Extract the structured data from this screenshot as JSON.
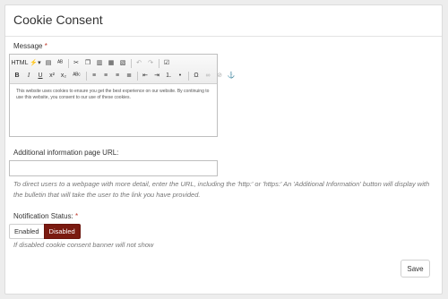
{
  "panel": {
    "title": "Cookie Consent"
  },
  "message": {
    "label": "Message",
    "required_mark": "*",
    "editor_text": "This website uses cookies to ensure you get the best experience on our website. By continuing to use this website, you consent to our use of these cookies."
  },
  "toolbar": {
    "row1": [
      {
        "name": "source-html-icon",
        "glyph": "HTML"
      },
      {
        "name": "special-char-dropdown-icon",
        "glyph": "⚡▾"
      },
      {
        "name": "print-icon",
        "glyph": "▤"
      },
      {
        "name": "spellcheck-icon",
        "glyph": "ᴬᴮ"
      },
      {
        "name": "cut-icon",
        "glyph": "✂"
      },
      {
        "name": "copy-icon",
        "glyph": "❐"
      },
      {
        "name": "paste-icon",
        "glyph": "▥"
      },
      {
        "name": "paste-text-icon",
        "glyph": "▦"
      },
      {
        "name": "paste-word-icon",
        "glyph": "▧"
      },
      {
        "name": "undo-icon",
        "glyph": "↶"
      },
      {
        "name": "redo-icon",
        "glyph": "↷"
      },
      {
        "name": "find-replace-icon",
        "glyph": "☑"
      }
    ],
    "row2": [
      {
        "name": "bold-icon",
        "glyph": "B"
      },
      {
        "name": "italic-icon",
        "glyph": "I"
      },
      {
        "name": "underline-icon",
        "glyph": "U"
      },
      {
        "name": "superscript-icon",
        "glyph": "x²"
      },
      {
        "name": "subscript-icon",
        "glyph": "x₂"
      },
      {
        "name": "strikethrough-icon",
        "glyph": "ᴬᴮᶜ"
      },
      {
        "name": "align-left-icon",
        "glyph": "≡"
      },
      {
        "name": "align-center-icon",
        "glyph": "≡"
      },
      {
        "name": "align-right-icon",
        "glyph": "≡"
      },
      {
        "name": "justify-icon",
        "glyph": "≣"
      },
      {
        "name": "outdent-icon",
        "glyph": "⇤"
      },
      {
        "name": "indent-icon",
        "glyph": "⇥"
      },
      {
        "name": "numbered-list-icon",
        "glyph": "⒈"
      },
      {
        "name": "bullet-list-icon",
        "glyph": "•"
      },
      {
        "name": "omega-icon",
        "glyph": "Ω"
      },
      {
        "name": "link-icon",
        "glyph": "∞"
      },
      {
        "name": "unlink-icon",
        "glyph": "⊘"
      },
      {
        "name": "anchor-icon",
        "glyph": "⚓"
      }
    ]
  },
  "url_field": {
    "label": "Additional information page URL:",
    "value": "",
    "placeholder": "",
    "help_text": "To direct users to a webpage with more detail, enter the URL, including the 'http:' or 'https:' An 'Additional Information' button will display with the bulletin that will take the user to the link you have provided."
  },
  "notification_status": {
    "label": "Notification Status:",
    "required_mark": "*",
    "options": [
      "Enabled",
      "Disabled"
    ],
    "selected": "Disabled",
    "selected_color": "#7a1a10",
    "help_text": "If disabled cookie consent banner will not show"
  },
  "actions": {
    "save_label": "Save"
  }
}
